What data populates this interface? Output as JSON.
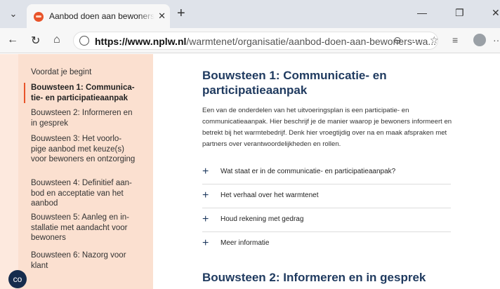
{
  "browser": {
    "tab_title": "Aanbod doen aan bewoners (warm",
    "url_host": "https://www.nplw.nl",
    "url_path": "/warmtenet/organisatie/aanbod-doen-aan-bewoners-wa..."
  },
  "sidebar": {
    "items": [
      {
        "label": "Voordat je begint"
      },
      {
        "label": "Bouwsteen 1: Communica-tie- en participatieaanpak"
      },
      {
        "label": "Bouwsteen 2: Informeren en in gesprek"
      },
      {
        "label": "Bouwsteen 3: Het voorlo-pige aanbod met keuze(s) voor bewoners en ontzorging"
      },
      {
        "label": "Bouwsteen 4: Definitief aan-bod en acceptatie van het aanbod"
      },
      {
        "label": "Bouwsteen 5: Aanleg en in-stallatie met aandacht voor bewoners"
      },
      {
        "label": "Bouwsteen 6: Nazorg voor klant"
      }
    ],
    "chat_icon_text": "co"
  },
  "main": {
    "heading": "Bouwsteen 1: Communicatie- en participatieaanpak",
    "intro": "Een van de onderdelen van het uitvoeringsplan is een participatie- en communicatieaanpak. Hier beschrijf je de manier waarop je bewoners informeert en betrekt bij het warmtebedrijf. Denk hier vroegtijdig over na en maak afspraken met partners over verantwoordelijkheden en rollen.",
    "accordions": [
      {
        "label": "Wat staat er in de communicatie- en participatieaanpak?"
      },
      {
        "label": "Het verhaal over het warmtenet"
      },
      {
        "label": "Houd rekening met gedrag"
      },
      {
        "label": "Meer informatie"
      }
    ],
    "next_heading": "Bouwsteen 2: Informeren en in gesprek"
  },
  "colors": {
    "accent": "#e8542a",
    "heading": "#1f3a5f",
    "sidebar_bg": "#fbe0d0"
  }
}
